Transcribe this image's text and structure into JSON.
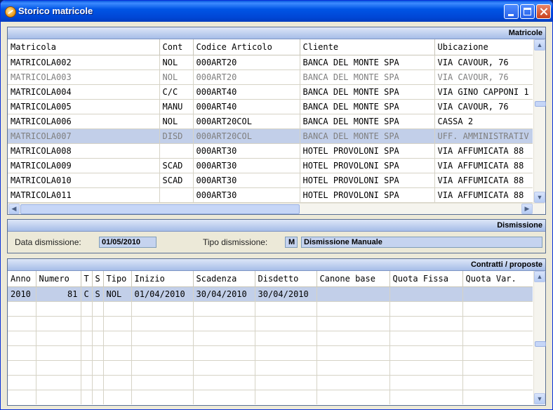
{
  "window": {
    "title": "Storico matricole"
  },
  "matricole": {
    "header": "Matricole",
    "columns": [
      "Matricola",
      "Cont",
      "Codice Articolo",
      "Cliente",
      "Ubicazione"
    ],
    "rows": [
      {
        "matricola": "MATRICOLA002",
        "cont": "NOL",
        "codice": "000ART20",
        "cliente": "BANCA DEL MONTE SPA",
        "ubicazione": "VIA CAVOUR, 76",
        "state": "normal"
      },
      {
        "matricola": "MATRICOLA003",
        "cont": "NOL",
        "codice": "000ART20",
        "cliente": "BANCA DEL MONTE SPA",
        "ubicazione": "VIA CAVOUR, 76",
        "state": "dim"
      },
      {
        "matricola": "MATRICOLA004",
        "cont": "C/C",
        "codice": "000ART40",
        "cliente": "BANCA DEL MONTE SPA",
        "ubicazione": "VIA GINO CAPPONI 1",
        "state": "normal"
      },
      {
        "matricola": "MATRICOLA005",
        "cont": "MANU",
        "codice": "000ART40",
        "cliente": "BANCA DEL MONTE SPA",
        "ubicazione": "VIA CAVOUR, 76",
        "state": "normal"
      },
      {
        "matricola": "MATRICOLA006",
        "cont": "NOL",
        "codice": "000ART20COL",
        "cliente": "BANCA DEL MONTE SPA",
        "ubicazione": "CASSA 2",
        "state": "normal"
      },
      {
        "matricola": "MATRICOLA007",
        "cont": "DISD",
        "codice": "000ART20COL",
        "cliente": "BANCA DEL MONTE SPA",
        "ubicazione": "UFF. AMMINISTRATIV",
        "state": "selected"
      },
      {
        "matricola": "MATRICOLA008",
        "cont": "",
        "codice": "000ART30",
        "cliente": "HOTEL PROVOLONI SPA",
        "ubicazione": "VIA AFFUMICATA 88",
        "state": "normal"
      },
      {
        "matricola": "MATRICOLA009",
        "cont": "SCAD",
        "codice": "000ART30",
        "cliente": "HOTEL PROVOLONI SPA",
        "ubicazione": "VIA AFFUMICATA 88",
        "state": "normal"
      },
      {
        "matricola": "MATRICOLA010",
        "cont": "SCAD",
        "codice": "000ART30",
        "cliente": "HOTEL PROVOLONI SPA",
        "ubicazione": "VIA AFFUMICATA 88",
        "state": "normal"
      },
      {
        "matricola": "MATRICOLA011",
        "cont": "",
        "codice": "000ART30",
        "cliente": "HOTEL PROVOLONI SPA",
        "ubicazione": "VIA AFFUMICATA 88",
        "state": "normal"
      }
    ]
  },
  "dismissione": {
    "header": "Dismissione",
    "data_label": "Data dismissione:",
    "data_value": "01/05/2010",
    "tipo_label": "Tipo dismissione:",
    "tipo_code": "M",
    "tipo_desc": "Dismissione Manuale"
  },
  "contratti": {
    "header": "Contratti / proposte",
    "columns": [
      "Anno",
      "Numero",
      "T",
      "S",
      "Tipo",
      "Inizio",
      "Scadenza",
      "Disdetto",
      "Canone base",
      "Quota Fissa",
      "Quota Var."
    ],
    "rows": [
      {
        "anno": "2010",
        "numero": "81",
        "t": "C",
        "s": "S",
        "tipo": "NOL",
        "inizio": "01/04/2010",
        "scadenza": "30/04/2010",
        "disdetto": "30/04/2010",
        "canone": "",
        "quota_fissa": "",
        "quota_var": ""
      }
    ],
    "empty_rows": 7
  },
  "colors": {
    "selected_row": "#c2cfe9",
    "panel_header": "#a6bde8",
    "field_bg": "#c5d3ef",
    "title_bar": "#0055e5"
  }
}
